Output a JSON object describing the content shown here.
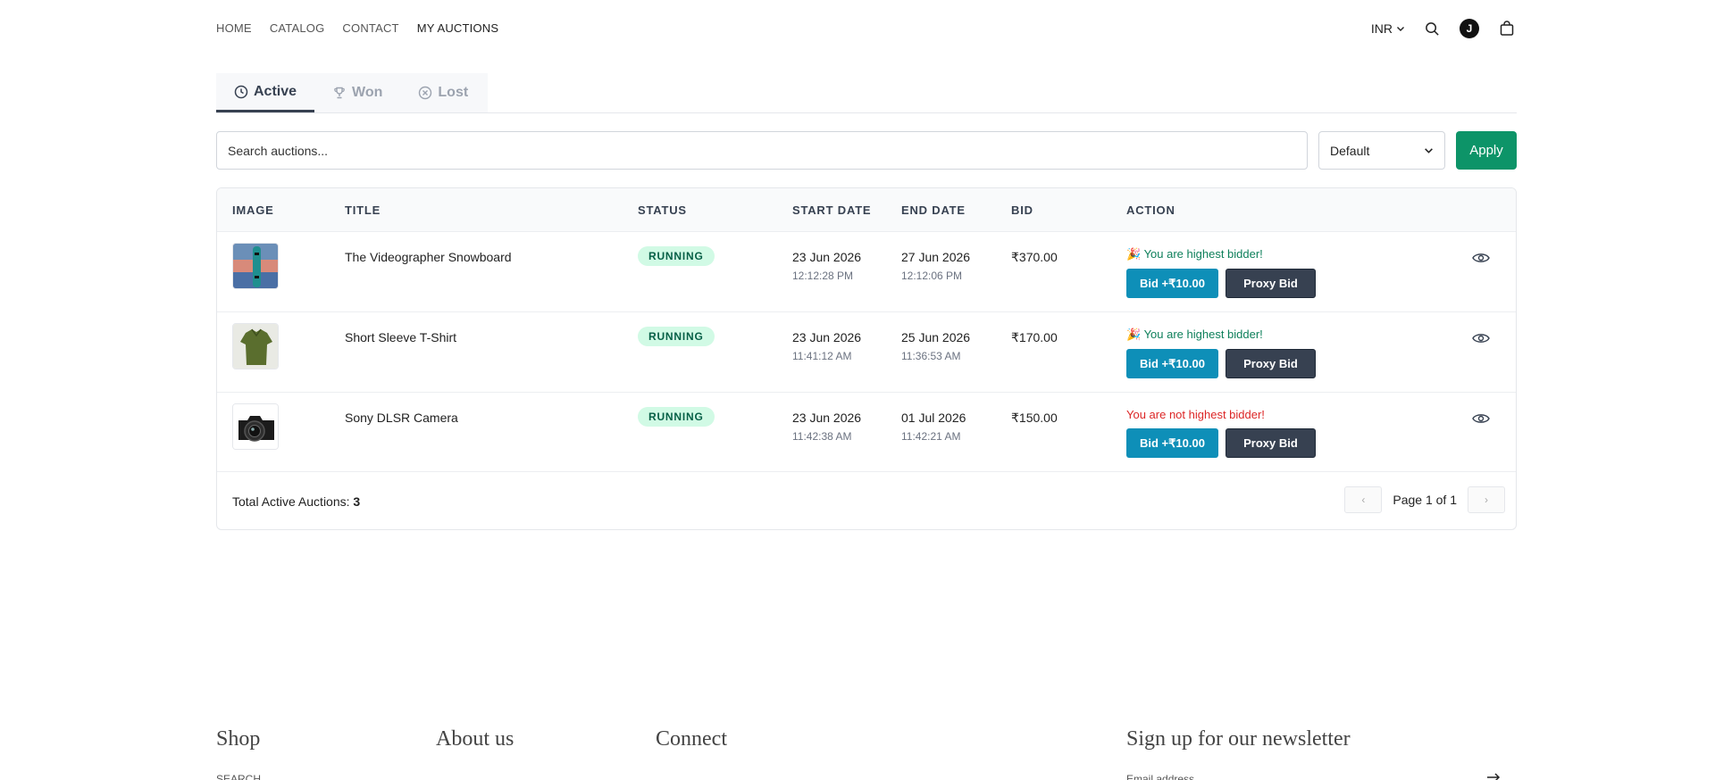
{
  "nav": {
    "items": [
      "HOME",
      "CATALOG",
      "CONTACT",
      "MY AUCTIONS"
    ],
    "active": "MY AUCTIONS"
  },
  "header": {
    "currency": "INR",
    "avatar_initial": "J",
    "icons": [
      "chevron-down-icon",
      "search-icon",
      "bag-icon"
    ]
  },
  "tabs": [
    {
      "label": "Active",
      "icon": "clock-icon"
    },
    {
      "label": "Won",
      "icon": "trophy-icon"
    },
    {
      "label": "Lost",
      "icon": "x-circle-icon"
    }
  ],
  "search": {
    "placeholder": "Search auctions...",
    "sort_value": "Default",
    "apply_label": "Apply"
  },
  "table": {
    "headers": [
      "IMAGE",
      "TITLE",
      "STATUS",
      "START DATE",
      "END DATE",
      "BID",
      "ACTION"
    ],
    "rows": [
      {
        "title": "The Videographer Snowboard",
        "status": "RUNNING",
        "start_date": "23 Jun 2026",
        "start_time": "12:12:28 PM",
        "end_date": "27 Jun 2026",
        "end_time": "12:12:06 PM",
        "bid": "₹370.00",
        "message": "🎉 You are highest bidder!",
        "message_type": "ok",
        "bid_button": "Bid +₹10.00",
        "proxy_button": "Proxy Bid"
      },
      {
        "title": "Short Sleeve T-Shirt",
        "status": "RUNNING",
        "start_date": "23 Jun 2026",
        "start_time": "11:41:12 AM",
        "end_date": "25 Jun 2026",
        "end_time": "11:36:53 AM",
        "bid": "₹170.00",
        "message": "🎉 You are highest bidder!",
        "message_type": "ok",
        "bid_button": "Bid +₹10.00",
        "proxy_button": "Proxy Bid"
      },
      {
        "title": "Sony DLSR Camera",
        "status": "RUNNING",
        "start_date": "23 Jun 2026",
        "start_time": "11:42:38 AM",
        "end_date": "01 Jul 2026",
        "end_time": "11:42:21 AM",
        "bid": "₹150.00",
        "message": "You are not highest bidder!",
        "message_type": "bad",
        "bid_button": "Bid +₹10.00",
        "proxy_button": "Proxy Bid"
      }
    ],
    "total_label": "Total Active Auctions:",
    "total_count": "3",
    "pager_text": "Page 1 of 1",
    "pager_prev": "‹",
    "pager_next": "›"
  },
  "footer": {
    "columns": [
      "Shop",
      "About us",
      "Connect"
    ],
    "newsletter_title": "Sign up for our newsletter",
    "shop_link": "SEARCH",
    "newsletter_placeholder": "Email address"
  },
  "colors": {
    "apply": "#0d9468",
    "bid_button": "#0e8fb8",
    "proxy_button": "#374151",
    "badge_bg": "#d1fae5",
    "success_text": "#0d7f5a",
    "error_text": "#dc2626"
  }
}
